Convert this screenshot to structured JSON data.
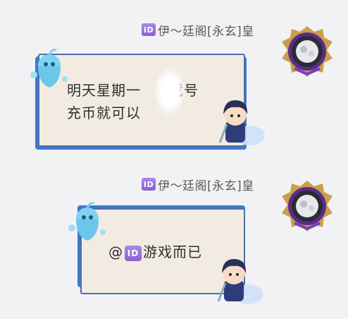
{
  "messages": [
    {
      "sender": {
        "badge": "ID",
        "name": "伊～廷阁[永玄]皇"
      },
      "lines": [
        "明天星期一",
        "戏号",
        "充币就可以"
      ]
    },
    {
      "sender": {
        "badge": "ID",
        "name": "伊～廷阁[永玄]皇"
      },
      "mention": {
        "at": "@",
        "badge": "ID",
        "text": "游戏而已"
      }
    }
  ],
  "colors": {
    "bubble_bg": "#f2ebe1",
    "bubble_border": "#4a6fae",
    "bubble_accent": "#3f78d2",
    "id_badge": "#9b6fe0",
    "sender_text": "#5a5a5e"
  },
  "icons": [
    "id-badge-icon",
    "avatar-purple-gold-frame",
    "ghost-sprite-icon",
    "chibi-character-icon"
  ]
}
